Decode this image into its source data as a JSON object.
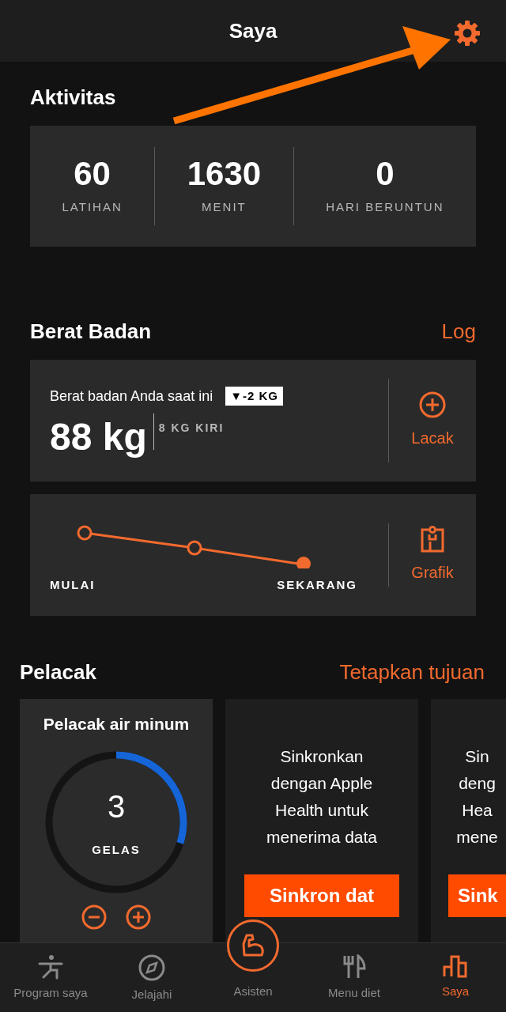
{
  "header": {
    "title": "Saya"
  },
  "activity": {
    "title": "Aktivitas",
    "stats": [
      {
        "value": "60",
        "label": "LATIHAN"
      },
      {
        "value": "1630",
        "label": "MENIT"
      },
      {
        "value": "0",
        "label": "HARI BERUNTUN"
      }
    ]
  },
  "weight": {
    "title": "Berat Badan",
    "action": "Log",
    "current_label": "Berat badan Anda saat ini",
    "change_badge": "▼-2 KG",
    "current_value": "88 kg",
    "remaining": "8 KG KIRI",
    "track_button": "Lacak",
    "start_label": "MULAI",
    "now_label": "SEKARANG",
    "chart_button": "Grafik"
  },
  "trackers": {
    "title": "Pelacak",
    "action": "Tetapkan tujuan",
    "cards": [
      {
        "kind": "water",
        "title": "Pelacak air minum",
        "count": "3",
        "unit": "GELAS",
        "level": 0.3
      },
      {
        "kind": "sync",
        "text_lines": [
          "Sinkronkan",
          "dengan Apple",
          "Health untuk",
          "menerima data"
        ],
        "button": "Sinkron dat"
      },
      {
        "kind": "sync",
        "text_lines": [
          "Sin",
          "deng",
          "Hea",
          "mene"
        ],
        "button": "Sink"
      }
    ]
  },
  "nav": [
    {
      "label": "Program saya",
      "kind": "person",
      "featured": false,
      "selected": false
    },
    {
      "label": "Jelajahi",
      "kind": "compass",
      "featured": false,
      "selected": false
    },
    {
      "label": "Asisten",
      "kind": "arm",
      "featured": true,
      "selected": false
    },
    {
      "label": "Menu diet",
      "kind": "cutlery",
      "featured": false,
      "selected": false
    },
    {
      "label": "Saya",
      "kind": "chart",
      "featured": false,
      "selected": true
    }
  ]
}
